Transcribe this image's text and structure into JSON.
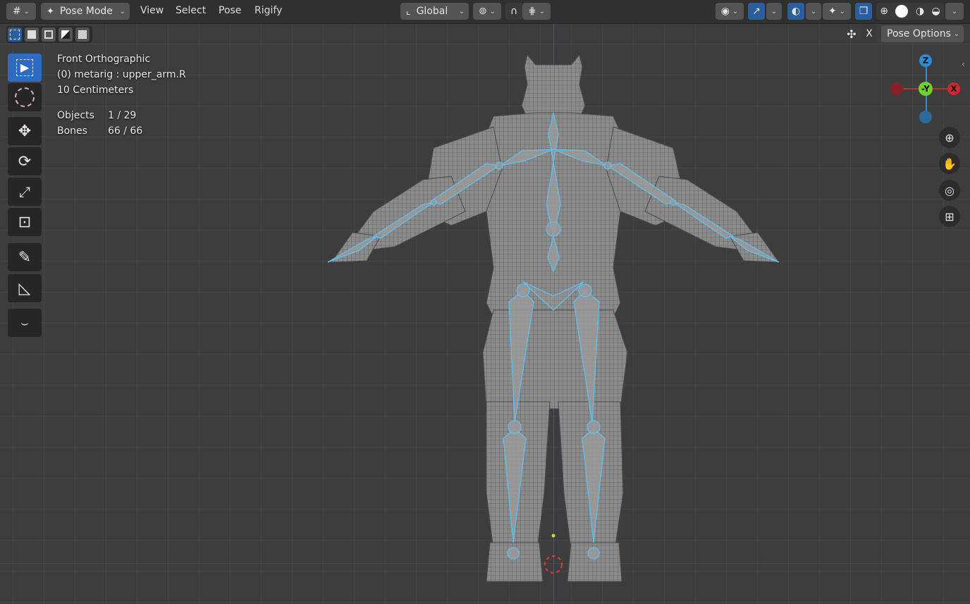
{
  "header": {
    "editor_type_icon": "3d-viewport-icon",
    "mode": {
      "label": "Pose Mode",
      "icon": "pose-icon"
    },
    "menus": [
      "View",
      "Select",
      "Pose",
      "Rigify"
    ],
    "transform_orientation": {
      "label": "Global",
      "icon": "orientation-icon"
    },
    "pivot_icon": "pivot-point-icon",
    "snap_icon": "snap-icon",
    "snap_target_icon": "snap-increment-icon",
    "visibility_icon": "eye-icon",
    "gizmo_icon": "gizmo-icon",
    "overlay_icon": "overlay-icon",
    "xray_icon": "xray-icon",
    "shading": [
      "wireframe",
      "solid",
      "material",
      "rendered"
    ],
    "active_shading": "solid"
  },
  "subheader": {
    "select_modes": [
      "set",
      "extend",
      "subtract",
      "invert",
      "intersect"
    ],
    "mirror_icon": "butterfly-mirror-icon",
    "mirror_label": "X",
    "pose_options_label": "Pose Options"
  },
  "tools": [
    {
      "name": "select-box",
      "icon": "select-box-icon",
      "active": true
    },
    {
      "name": "cursor",
      "icon": "cursor-icon",
      "active": false
    },
    {
      "name": "move",
      "icon": "move-icon",
      "active": false
    },
    {
      "name": "rotate",
      "icon": "rotate-icon",
      "active": false
    },
    {
      "name": "scale",
      "icon": "scale-icon",
      "active": false
    },
    {
      "name": "transform",
      "icon": "transform-icon",
      "active": false
    },
    {
      "name": "annotate",
      "icon": "annotate-icon",
      "active": false
    },
    {
      "name": "measure",
      "icon": "measure-icon",
      "active": false
    },
    {
      "name": "relax-pose",
      "icon": "pose-relax-icon",
      "active": false
    }
  ],
  "overlay": {
    "view_name": "Front Orthographic",
    "active": "(0) metarig : upper_arm.R",
    "scale": "10 Centimeters",
    "stats": [
      {
        "label": "Objects",
        "value": "1 / 29"
      },
      {
        "label": "Bones",
        "value": "66 / 66"
      }
    ]
  },
  "gizmo": {
    "z_label": "Z",
    "y_label": "-Y",
    "x_label": "X",
    "colors": {
      "x": "#d0262f",
      "y": "#6fd12c",
      "z": "#2a8ed6"
    }
  },
  "nav_buttons": [
    "zoom-icon",
    "pan-hand-icon",
    "camera-icon",
    "grid-ortho-icon"
  ],
  "colors": {
    "accent": "#2d6cc0",
    "bone_outline": "#5fc0ef",
    "background": "#3d3d3d"
  }
}
